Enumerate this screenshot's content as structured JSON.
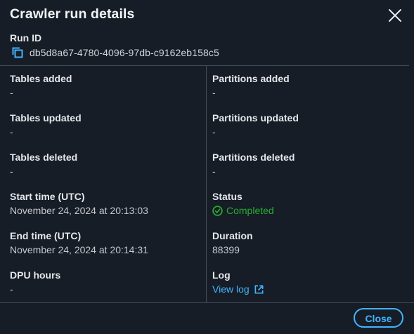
{
  "modal": {
    "title": "Crawler run details",
    "close_icon": "close-icon"
  },
  "run_id": {
    "label": "Run ID",
    "value": "db5d8a67-4780-4096-97db-c9162eb158c5",
    "copy_icon": "copy-icon"
  },
  "left_fields": [
    {
      "label": "Tables added",
      "value": "-"
    },
    {
      "label": "Tables updated",
      "value": "-"
    },
    {
      "label": "Tables deleted",
      "value": "-"
    },
    {
      "label": "Start time (UTC)",
      "value": "November 24, 2024 at 20:13:03"
    },
    {
      "label": "End time (UTC)",
      "value": "November 24, 2024 at 20:14:31"
    },
    {
      "label": "DPU hours",
      "value": "-"
    }
  ],
  "right_fields": {
    "partitions_added": {
      "label": "Partitions added",
      "value": "-"
    },
    "partitions_updated": {
      "label": "Partitions updated",
      "value": "-"
    },
    "partitions_deleted": {
      "label": "Partitions deleted",
      "value": "-"
    },
    "status": {
      "label": "Status",
      "value": "Completed",
      "icon": "check-circle-icon",
      "color": "#29ad32"
    },
    "duration": {
      "label": "Duration",
      "value": "88399"
    },
    "log": {
      "label": "Log",
      "link_text": "View log",
      "icon": "external-link-icon",
      "link_color": "#42b4ff"
    }
  },
  "footer": {
    "close_label": "Close"
  },
  "colors": {
    "background": "#161d26",
    "divider": "#414d5c",
    "accent": "#42b4ff",
    "success": "#29ad32"
  }
}
